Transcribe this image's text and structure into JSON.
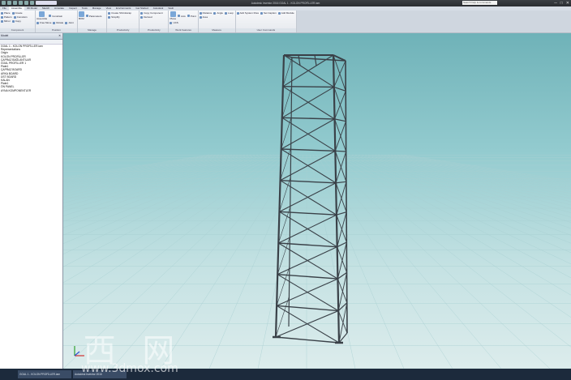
{
  "app": {
    "title": "Autodesk Inventor 2016   GOAL 1 - KOLON PROFİLLER.iam",
    "search_placeholder": "Search help & commands",
    "window_controls": [
      "─",
      "□",
      "✕"
    ]
  },
  "ribbon": {
    "tabs": [
      "File",
      "Assemble",
      "3D Model",
      "Sketch",
      "Annotate",
      "Inspect",
      "Tools",
      "Manage",
      "View",
      "Environments",
      "Get Started",
      "Autodesk",
      "Vault"
    ],
    "active_tab": "Assemble",
    "panels": [
      {
        "label": "Component",
        "items": [
          "Place",
          "Create",
          "Pattern",
          "Constrain",
          "Mirror",
          "Copy"
        ]
      },
      {
        "label": "Position",
        "items": [
          "Assemble",
          "Constrain",
          "Free Move",
          "Rotate",
          "Joint"
        ]
      },
      {
        "label": "Manage",
        "items": [
          "BOM",
          "Parameters"
        ]
      },
      {
        "label": "Productivity",
        "items": [
          "Create Shrinkwrap",
          "Simplify"
        ]
      },
      {
        "label": "Productivity",
        "items": [
          "Copy Component",
          "Derived"
        ]
      },
      {
        "label": "Work Features",
        "items": [
          "Plane",
          "Axis",
          "Point",
          "UCS"
        ]
      },
      {
        "label": "Measure",
        "items": [
          "Distance",
          "Angle",
          "Loop",
          "Area"
        ]
      },
      {
        "label": "User Commands",
        "items": [
          "Add System Files",
          "Set Caption",
          "Add Module"
        ]
      }
    ]
  },
  "browser": {
    "title": "Model",
    "close": "✕",
    "items": [
      "GOAL 1 - KOLON PROFİLLER.iam",
      "Representations",
      "Origin",
      "KOLON PROFİLLER",
      "ÇAPRAZ BAĞLANTILAR",
      "GOAL PROFİLLER 1",
      "Plate1",
      "ÇAPRAZ BOARD",
      "ARKA BOARD",
      "ÜST BOARD",
      "KALAN",
      "Plate1",
      "ÖN PANEL",
      "AYNA KOMPONENTLER"
    ]
  },
  "status": {
    "taskbar": [
      "GOAL 1 - KOLON PROFİLLER.iam",
      "Autodesk Inventor 2016"
    ]
  },
  "watermark": {
    "text": "莫 西 网",
    "url": "www.3dmox.com"
  },
  "colors": {
    "viewport_top": "#6fb2b8",
    "viewport_bottom": "#dcecec",
    "frame": "#3a4148",
    "grid": "#a8cfd2"
  }
}
